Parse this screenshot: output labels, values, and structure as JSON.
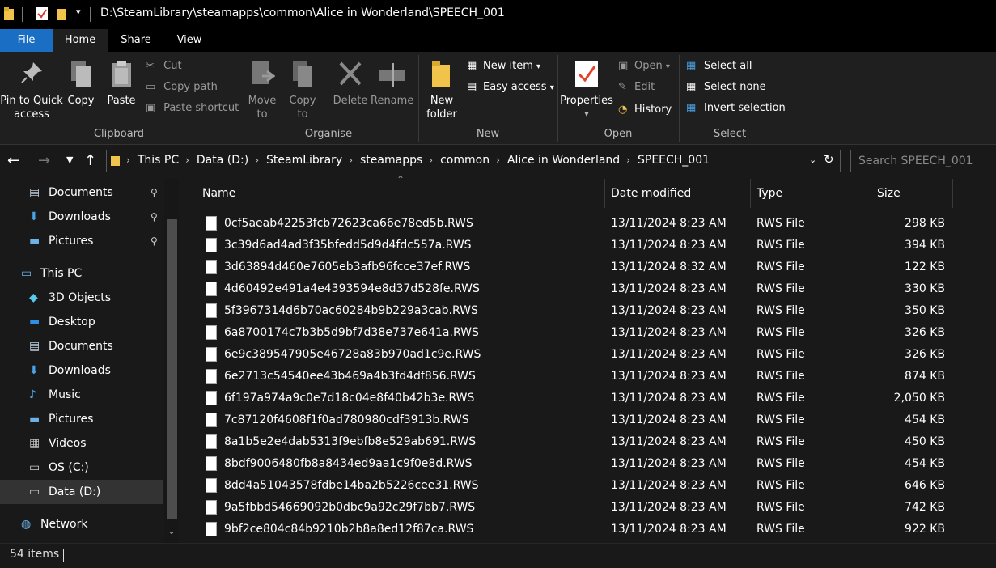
{
  "window": {
    "title": "D:\\SteamLibrary\\steamapps\\common\\Alice in Wonderland\\SPEECH_001"
  },
  "ribbon_tabs": [
    "File",
    "Home",
    "Share",
    "View"
  ],
  "clipboard": {
    "pin": "Pin to Quick",
    "pin2": "access",
    "copy": "Copy",
    "paste": "Paste",
    "cut": "Cut",
    "copy_path": "Copy path",
    "paste_shortcut": "Paste shortcut",
    "label": "Clipboard"
  },
  "organise": {
    "move": "Move",
    "move2": "to",
    "copy": "Copy",
    "copy2": "to",
    "delete": "Delete",
    "rename": "Rename",
    "label": "Organise"
  },
  "new": {
    "new_folder": "New",
    "new_folder2": "folder",
    "new_item": "New item",
    "easy_access": "Easy access",
    "label": "New"
  },
  "open": {
    "properties": "Properties",
    "open": "Open",
    "edit": "Edit",
    "history": "History",
    "label": "Open"
  },
  "select": {
    "select_all": "Select all",
    "select_none": "Select none",
    "invert": "Invert selection",
    "label": "Select"
  },
  "breadcrumb": [
    "This PC",
    "Data (D:)",
    "SteamLibrary",
    "steamapps",
    "common",
    "Alice in Wonderland",
    "SPEECH_001"
  ],
  "search": {
    "placeholder": "Search SPEECH_001"
  },
  "nav": {
    "quick": [
      "Documents",
      "Downloads",
      "Pictures"
    ],
    "this_pc": "This PC",
    "pc_items": [
      "3D Objects",
      "Desktop",
      "Documents",
      "Downloads",
      "Music",
      "Pictures",
      "Videos",
      "OS (C:)",
      "Data (D:)"
    ],
    "network": "Network"
  },
  "columns": [
    "Name",
    "Date modified",
    "Type",
    "Size"
  ],
  "files": [
    [
      "0cf5aeab42253fcb72623ca66e78ed5b.RWS",
      "13/11/2024 8:23 AM",
      "RWS File",
      "298 KB"
    ],
    [
      "3c39d6ad4ad3f35bfedd5d9d4fdc557a.RWS",
      "13/11/2024 8:23 AM",
      "RWS File",
      "394 KB"
    ],
    [
      "3d63894d460e7605eb3afb96fcce37ef.RWS",
      "13/11/2024 8:32 AM",
      "RWS File",
      "122 KB"
    ],
    [
      "4d60492e491a4e4393594e8d37d528fe.RWS",
      "13/11/2024 8:23 AM",
      "RWS File",
      "330 KB"
    ],
    [
      "5f3967314d6b70ac60284b9b229a3cab.RWS",
      "13/11/2024 8:23 AM",
      "RWS File",
      "350 KB"
    ],
    [
      "6a8700174c7b3b5d9bf7d38e737e641a.RWS",
      "13/11/2024 8:23 AM",
      "RWS File",
      "326 KB"
    ],
    [
      "6e9c389547905e46728a83b970ad1c9e.RWS",
      "13/11/2024 8:23 AM",
      "RWS File",
      "326 KB"
    ],
    [
      "6e2713c54540ee43b469a4b3fd4df856.RWS",
      "13/11/2024 8:23 AM",
      "RWS File",
      "874 KB"
    ],
    [
      "6f197a974a9c0e7d18c04e8f40b42b3e.RWS",
      "13/11/2024 8:23 AM",
      "RWS File",
      "2,050 KB"
    ],
    [
      "7c87120f4608f1f0ad780980cdf3913b.RWS",
      "13/11/2024 8:23 AM",
      "RWS File",
      "454 KB"
    ],
    [
      "8a1b5e2e4dab5313f9ebfb8e529ab691.RWS",
      "13/11/2024 8:23 AM",
      "RWS File",
      "450 KB"
    ],
    [
      "8bdf9006480fb8a8434ed9aa1c9f0e8d.RWS",
      "13/11/2024 8:23 AM",
      "RWS File",
      "454 KB"
    ],
    [
      "8dd4a51043578fdbe14ba2b5226cee31.RWS",
      "13/11/2024 8:23 AM",
      "RWS File",
      "646 KB"
    ],
    [
      "9a5fbbd54669092b0dbc9a92c29f7bb7.RWS",
      "13/11/2024 8:23 AM",
      "RWS File",
      "742 KB"
    ],
    [
      "9bf2ce804c84b9210b2b8a8ed12f87ca.RWS",
      "13/11/2024 8:23 AM",
      "RWS File",
      "922 KB"
    ]
  ],
  "status": {
    "count": "54 items"
  },
  "colors": {
    "accent": "#1a6fc4",
    "folder": "#f2c34b"
  }
}
